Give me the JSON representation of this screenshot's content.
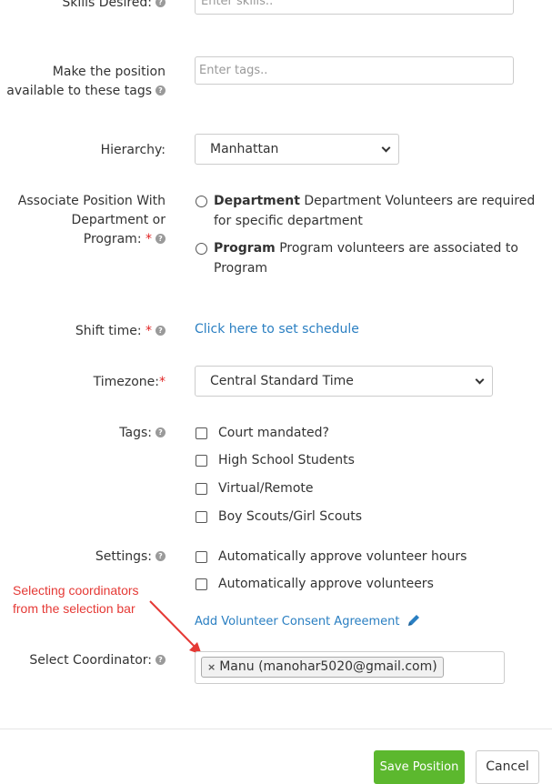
{
  "skills": {
    "label": "Skills Desired:",
    "placeholder": "Enter skills.."
  },
  "tags_availability": {
    "label_line1": "Make the position",
    "label_line2": "available to these tags",
    "placeholder": "Enter tags.."
  },
  "hierarchy": {
    "label": "Hierarchy:",
    "selected": "Manhattan"
  },
  "associate": {
    "label_line1": "Associate Position With",
    "label_line2": "Department or",
    "label_line3": "Program:",
    "required": "*",
    "options": [
      {
        "title": "Department",
        "desc_line1": "Department Volunteers are required",
        "desc_line2": "for specific department"
      },
      {
        "title": "Program",
        "desc_line1": "Program volunteers are associated to",
        "desc_line2": "Program"
      }
    ]
  },
  "shift": {
    "label": "Shift time:",
    "required": "*",
    "link": "Click here to set schedule"
  },
  "timezone": {
    "label": "Timezone:",
    "required": "*",
    "selected": "Central Standard Time"
  },
  "tags": {
    "label": "Tags:",
    "options": [
      "Court mandated?",
      "High School Students",
      "Virtual/Remote",
      "Boy Scouts/Girl Scouts"
    ]
  },
  "settings": {
    "label": "Settings:",
    "options": [
      "Automatically approve volunteer hours",
      "Automatically approve volunteers"
    ],
    "consent_link": "Add Volunteer Consent Agreement"
  },
  "annotation": {
    "line1": "Selecting coordinators",
    "line2": "from the selection bar"
  },
  "coordinator": {
    "label": "Select Coordinator:",
    "chip_remove": "×",
    "chip_text": "Manu (manohar5020@gmail.com)"
  },
  "footer": {
    "save": "Save Position",
    "cancel": "Cancel"
  },
  "colors": {
    "accent_link": "#2a7fc2",
    "save_green": "#5cb82e",
    "required_red": "#e02424",
    "annotation_red": "#e53935"
  },
  "icons": {
    "help": "question-circle-icon",
    "pencil": "pencil-icon",
    "chevron": "chevron-down-icon"
  }
}
